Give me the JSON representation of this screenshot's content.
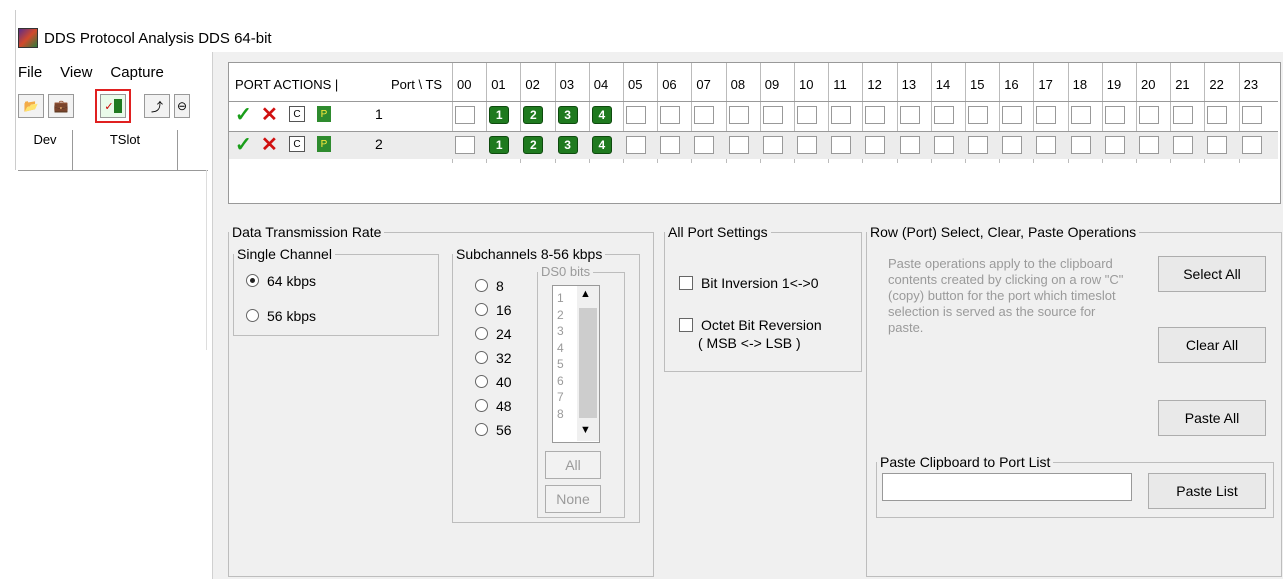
{
  "window": {
    "title": "DDS Protocol Analysis DDS 64-bit"
  },
  "menu": [
    "File",
    "View",
    "Capture"
  ],
  "toolbar": {
    "icons": [
      "open-folder-icon",
      "briefcase-icon",
      "timeslot-select-icon",
      "connect-icon",
      "stop-icon"
    ]
  },
  "side_columns": [
    "Dev",
    "TSlot"
  ],
  "grid": {
    "port_actions_label": "PORT ACTIONS |",
    "port_ts_label": "Port \\ TS",
    "timeslots": [
      "00",
      "01",
      "02",
      "03",
      "04",
      "05",
      "06",
      "07",
      "08",
      "09",
      "10",
      "11",
      "12",
      "13",
      "14",
      "15",
      "16",
      "17",
      "18",
      "19",
      "20",
      "21",
      "22",
      "23"
    ],
    "rows": [
      {
        "port": "1",
        "selected": [
          "01",
          "02",
          "03",
          "04"
        ],
        "badges": [
          "1",
          "2",
          "3",
          "4"
        ]
      },
      {
        "port": "2",
        "selected": [
          "01",
          "02",
          "03",
          "04"
        ],
        "badges": [
          "1",
          "2",
          "3",
          "4"
        ]
      }
    ],
    "action_glyphs": {
      "check": "✓",
      "x": "✕",
      "copy": "C",
      "paste": "P"
    }
  },
  "rate": {
    "group_title": "Data Transmission Rate",
    "single": {
      "title": "Single Channel",
      "options": [
        "64 kbps",
        "56 kbps"
      ],
      "selected": "64 kbps"
    },
    "sub": {
      "title": "Subchannels 8-56 kbps",
      "options": [
        "8",
        "16",
        "24",
        "32",
        "40",
        "48",
        "56"
      ],
      "ds0_title": "DS0 bits",
      "ds0_bits": [
        "1",
        "2",
        "3",
        "4",
        "5",
        "6",
        "7",
        "8"
      ],
      "all_label": "All",
      "none_label": "None"
    }
  },
  "allport": {
    "title": "All Port Settings",
    "bit_inversion": "Bit Inversion 1<->0",
    "octet_reversal": "Octet Bit Reversion",
    "octet_reversal_sub": "( MSB <-> LSB )"
  },
  "rowops": {
    "title": "Row (Port) Select, Clear, Paste Operations",
    "help": "Paste operations apply to the clipboard contents created by clicking on a row \"C\" (copy) button for the port which timeslot selection is served as the source for paste.",
    "select_all": "Select All",
    "clear_all": "Clear All",
    "paste_all": "Paste All",
    "paste_list_title": "Paste Clipboard to Port List",
    "paste_list_value": "",
    "paste_list_btn": "Paste List"
  }
}
